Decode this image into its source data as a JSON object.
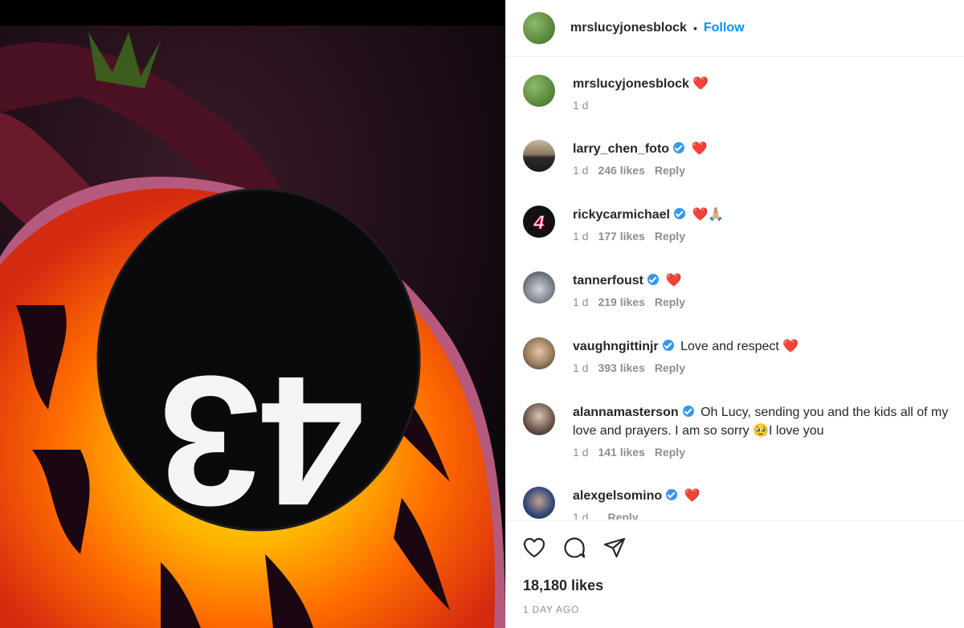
{
  "post": {
    "author": "mrslucyjonesblock",
    "follow_label": "Follow",
    "separator": "•",
    "photo_number": "43",
    "likes_label": "18,180 likes",
    "date_label": "1 DAY AGO"
  },
  "caption": {
    "user": "mrslucyjonesblock",
    "text": "❤️",
    "time": "1 d"
  },
  "comments": [
    {
      "user": "larry_chen_foto",
      "verified": true,
      "text": "❤️",
      "time": "1 d",
      "likes": "246 likes",
      "reply": "Reply"
    },
    {
      "user": "rickycarmichael",
      "verified": true,
      "text": "❤️🙏🏼",
      "time": "1 d",
      "likes": "177 likes",
      "reply": "Reply"
    },
    {
      "user": "tannerfoust",
      "verified": true,
      "text": "❤️",
      "time": "1 d",
      "likes": "219 likes",
      "reply": "Reply"
    },
    {
      "user": "vaughngittinjr",
      "verified": true,
      "text": "Love and respect ❤️",
      "time": "1 d",
      "likes": "393 likes",
      "reply": "Reply"
    },
    {
      "user": "alannamasterson",
      "verified": true,
      "text": "Oh Lucy, sending you and the kids all of my love and prayers. I am so sorry 🥹I love you",
      "time": "1 d",
      "likes": "141 likes",
      "reply": "Reply"
    },
    {
      "user": "alexgelsomino",
      "verified": true,
      "text": "❤️",
      "time": "1 d",
      "likes": "",
      "reply": "Reply"
    }
  ],
  "icons": {
    "like": "heart-icon",
    "comment": "comment-icon",
    "share": "share-icon",
    "verified": "verified-badge-icon"
  },
  "colors": {
    "follow": "#0095f6",
    "verified": "#3897f0",
    "heart": "#ed1c24"
  }
}
